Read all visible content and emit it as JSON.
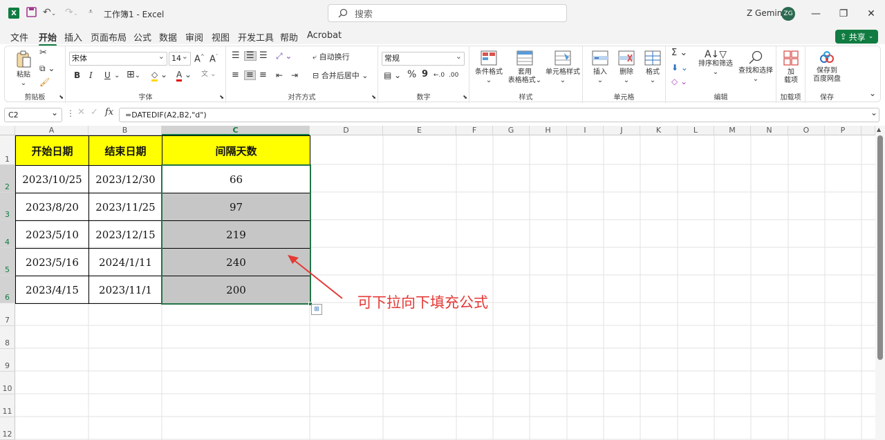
{
  "app": {
    "title": "工作簿1 - Excel",
    "search_placeholder": "搜索",
    "user_name": "Z Gemini",
    "user_initials": "ZG",
    "accent": "#107c41"
  },
  "menu": {
    "items": [
      "文件",
      "开始",
      "插入",
      "页面布局",
      "公式",
      "数据",
      "审阅",
      "视图",
      "开发工具",
      "帮助",
      "Acrobat"
    ],
    "active": "开始",
    "share_label": "共享"
  },
  "ribbon": {
    "clipboard": {
      "paste": "粘贴",
      "label": "剪贴板"
    },
    "font": {
      "name": "宋体",
      "size": "14",
      "label": "字体",
      "bold": "B",
      "italic": "I",
      "underline": "U"
    },
    "align": {
      "wrap": "自动换行",
      "merge": "合并后居中",
      "label": "对齐方式"
    },
    "number": {
      "format": "常规",
      "label": "数字",
      "percent": "%",
      "comma": "9"
    },
    "styles": {
      "cond": "条件格式",
      "table_l1": "套用",
      "table_l2": "表格格式",
      "cell": "单元格样式",
      "label": "样式"
    },
    "cells": {
      "insert": "插入",
      "delete": "删除",
      "format": "格式",
      "label": "单元格"
    },
    "edit": {
      "sort": "排序和筛选",
      "find": "查找和选择",
      "label": "编辑"
    },
    "addins": {
      "l1": "加",
      "l2": "载项",
      "label": "加载项"
    },
    "save": {
      "l1": "保存到",
      "l2": "百度网盘",
      "label": "保存"
    }
  },
  "formula_bar": {
    "name_box": "C2",
    "formula": "=DATEDIF(A2,B2,\"d\")",
    "fx": "fx"
  },
  "columns": [
    "A",
    "B",
    "C",
    "D",
    "E",
    "F",
    "G",
    "H",
    "I",
    "J",
    "K",
    "L",
    "M",
    "N",
    "O",
    "P"
  ],
  "rows": [
    "1",
    "2",
    "3",
    "4",
    "5",
    "6",
    "7",
    "8",
    "9",
    "10",
    "11",
    "12"
  ],
  "table": {
    "headers": [
      "开始日期",
      "结束日期",
      "间隔天数"
    ],
    "rows": [
      [
        "2023/10/25",
        "2023/12/30",
        "66"
      ],
      [
        "2023/8/20",
        "2023/11/25",
        "97"
      ],
      [
        "2023/5/10",
        "2023/12/15",
        "219"
      ],
      [
        "2023/5/16",
        "2024/1/11",
        "240"
      ],
      [
        "2023/4/15",
        "2023/11/1",
        "200"
      ]
    ]
  },
  "annotation": "可下拉向下填充公式",
  "colors": {
    "header_fill": "#ffff00",
    "selection_fill": "#c6c6c6",
    "annotation": "#e53935"
  }
}
